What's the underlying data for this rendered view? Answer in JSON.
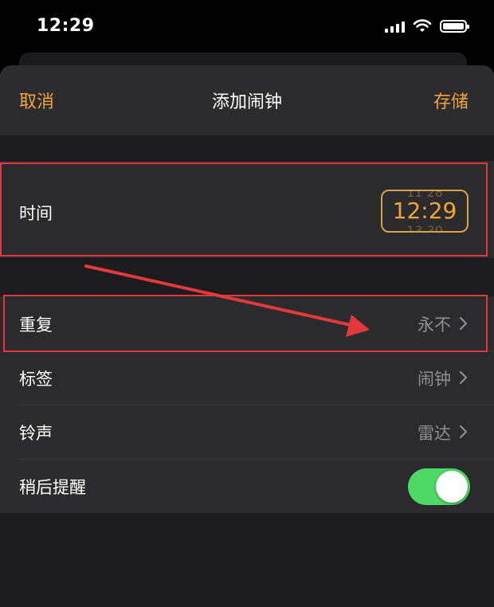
{
  "status_bar": {
    "time": "12:29",
    "icons": [
      "cellular-signal-icon",
      "wifi-icon",
      "battery-icon"
    ]
  },
  "nav": {
    "cancel": "取消",
    "title": "添加闹钟",
    "save": "存储",
    "accent_color": "#f1a43a"
  },
  "time_row": {
    "label": "时间",
    "value": "12:29",
    "ghost_above": "11 28",
    "ghost_below": "13 30"
  },
  "settings": {
    "rows": [
      {
        "label": "重复",
        "value": "永不"
      },
      {
        "label": "标签",
        "value": "闹钟"
      },
      {
        "label": "铃声",
        "value": "雷达"
      }
    ],
    "snooze": {
      "label": "稍后提醒",
      "enabled": true,
      "toggle_color": "#4cd964"
    }
  },
  "annotation": {
    "color": "#e23a3a"
  }
}
